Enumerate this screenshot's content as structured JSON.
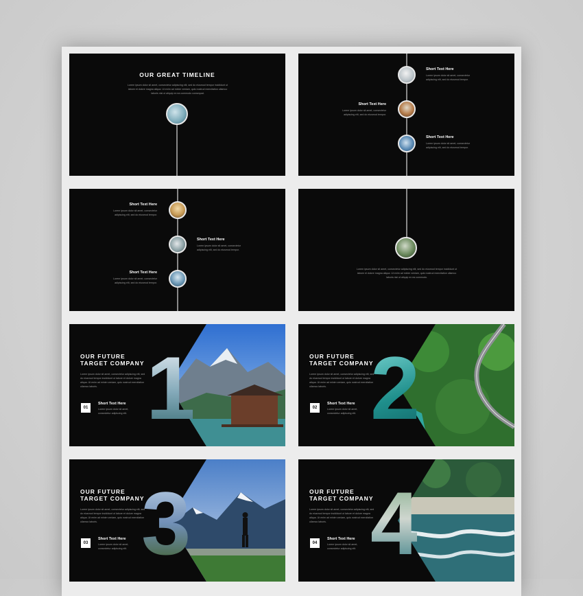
{
  "slides": {
    "s1": {
      "title": "OUR GREAT TIMELINE",
      "body": "Lorem ipsum dolor sit amet, consectetur adipiscing elit, sed do eiusmod tempor incididunt ut labore et dolore magna aliqua. Ut enim ad minim veniam, quis nostrud exercitation ullamco laboris nisi ut aliquip ex ea commodo consequat."
    },
    "s2": {
      "items": [
        {
          "title": "Short Text Here",
          "body": "Lorem ipsum dolor sit amet, consectetur adipiscing elit, sed do eiusmod tempor."
        },
        {
          "title": "Short Text Here",
          "body": "Lorem ipsum dolor sit amet, consectetur adipiscing elit, sed do eiusmod tempor."
        },
        {
          "title": "Short Text Here",
          "body": "Lorem ipsum dolor sit amet, consectetur adipiscing elit, sed do eiusmod tempor."
        }
      ]
    },
    "s3": {
      "items": [
        {
          "title": "Short Text Here",
          "body": "Lorem ipsum dolor sit amet, consectetur adipiscing elit, sed do eiusmod tempor."
        },
        {
          "title": "Short Text Here",
          "body": "Lorem ipsum dolor sit amet, consectetur adipiscing elit, sed do eiusmod tempor."
        },
        {
          "title": "Short Text Here",
          "body": "Lorem ipsum dolor sit amet, consectetur adipiscing elit, sed do eiusmod tempor."
        }
      ]
    },
    "s4": {
      "body": "Lorem ipsum dolor sit amet, consectetur adipiscing elit, sed do eiusmod tempor incididunt ut labore et dolore magna aliqua. Ut enim ad minim veniam, quis nostrud exercitation ullamco laboris nisi ut aliquip ex ea commodo."
    },
    "s5": {
      "title": "OUR FUTURE TARGET COMPANY",
      "body": "Lorem ipsum dolor sit amet, consectetur adipiscing elit, sed do eiusmod tempor incididunt ut labore et dolore magna aliqua. Ut enim ad minim veniam, quis nostrud exercitation ullamco laboris.",
      "num": "01",
      "short": "Short Text Here",
      "short_body": "Lorem ipsum dolor sit amet, consectetur adipiscing elit.",
      "big": "1"
    },
    "s6": {
      "title": "OUR FUTURE TARGET COMPANY",
      "body": "Lorem ipsum dolor sit amet, consectetur adipiscing elit, sed do eiusmod tempor incididunt ut labore et dolore magna aliqua. Ut enim ad minim veniam, quis nostrud exercitation ullamco laboris.",
      "num": "02",
      "short": "Short Text Here",
      "short_body": "Lorem ipsum dolor sit amet, consectetur adipiscing elit.",
      "big": "2"
    },
    "s7": {
      "title": "OUR FUTURE TARGET COMPANY",
      "body": "Lorem ipsum dolor sit amet, consectetur adipiscing elit, sed do eiusmod tempor incididunt ut labore et dolore magna aliqua. Ut enim ad minim veniam, quis nostrud exercitation ullamco laboris.",
      "num": "03",
      "short": "Short Text Here",
      "short_body": "Lorem ipsum dolor sit amet, consectetur adipiscing elit.",
      "big": "3"
    },
    "s8": {
      "title": "OUR FUTURE TARGET COMPANY",
      "body": "Lorem ipsum dolor sit amet, consectetur adipiscing elit, sed do eiusmod tempor incididunt ut labore et dolore magna aliqua. Ut enim ad minim veniam, quis nostrud exercitation ullamco laboris.",
      "num": "04",
      "short": "Short Text Here",
      "short_body": "Lorem ipsum dolor sit amet, consectetur adipiscing elit.",
      "big": "4"
    }
  },
  "colors": {
    "slide_bg": "#0a0a0a",
    "sheet_bg": "#ececec",
    "text_white": "#ffffff",
    "text_gray": "#9a9a9a",
    "line_gray": "#8a8a8a"
  }
}
